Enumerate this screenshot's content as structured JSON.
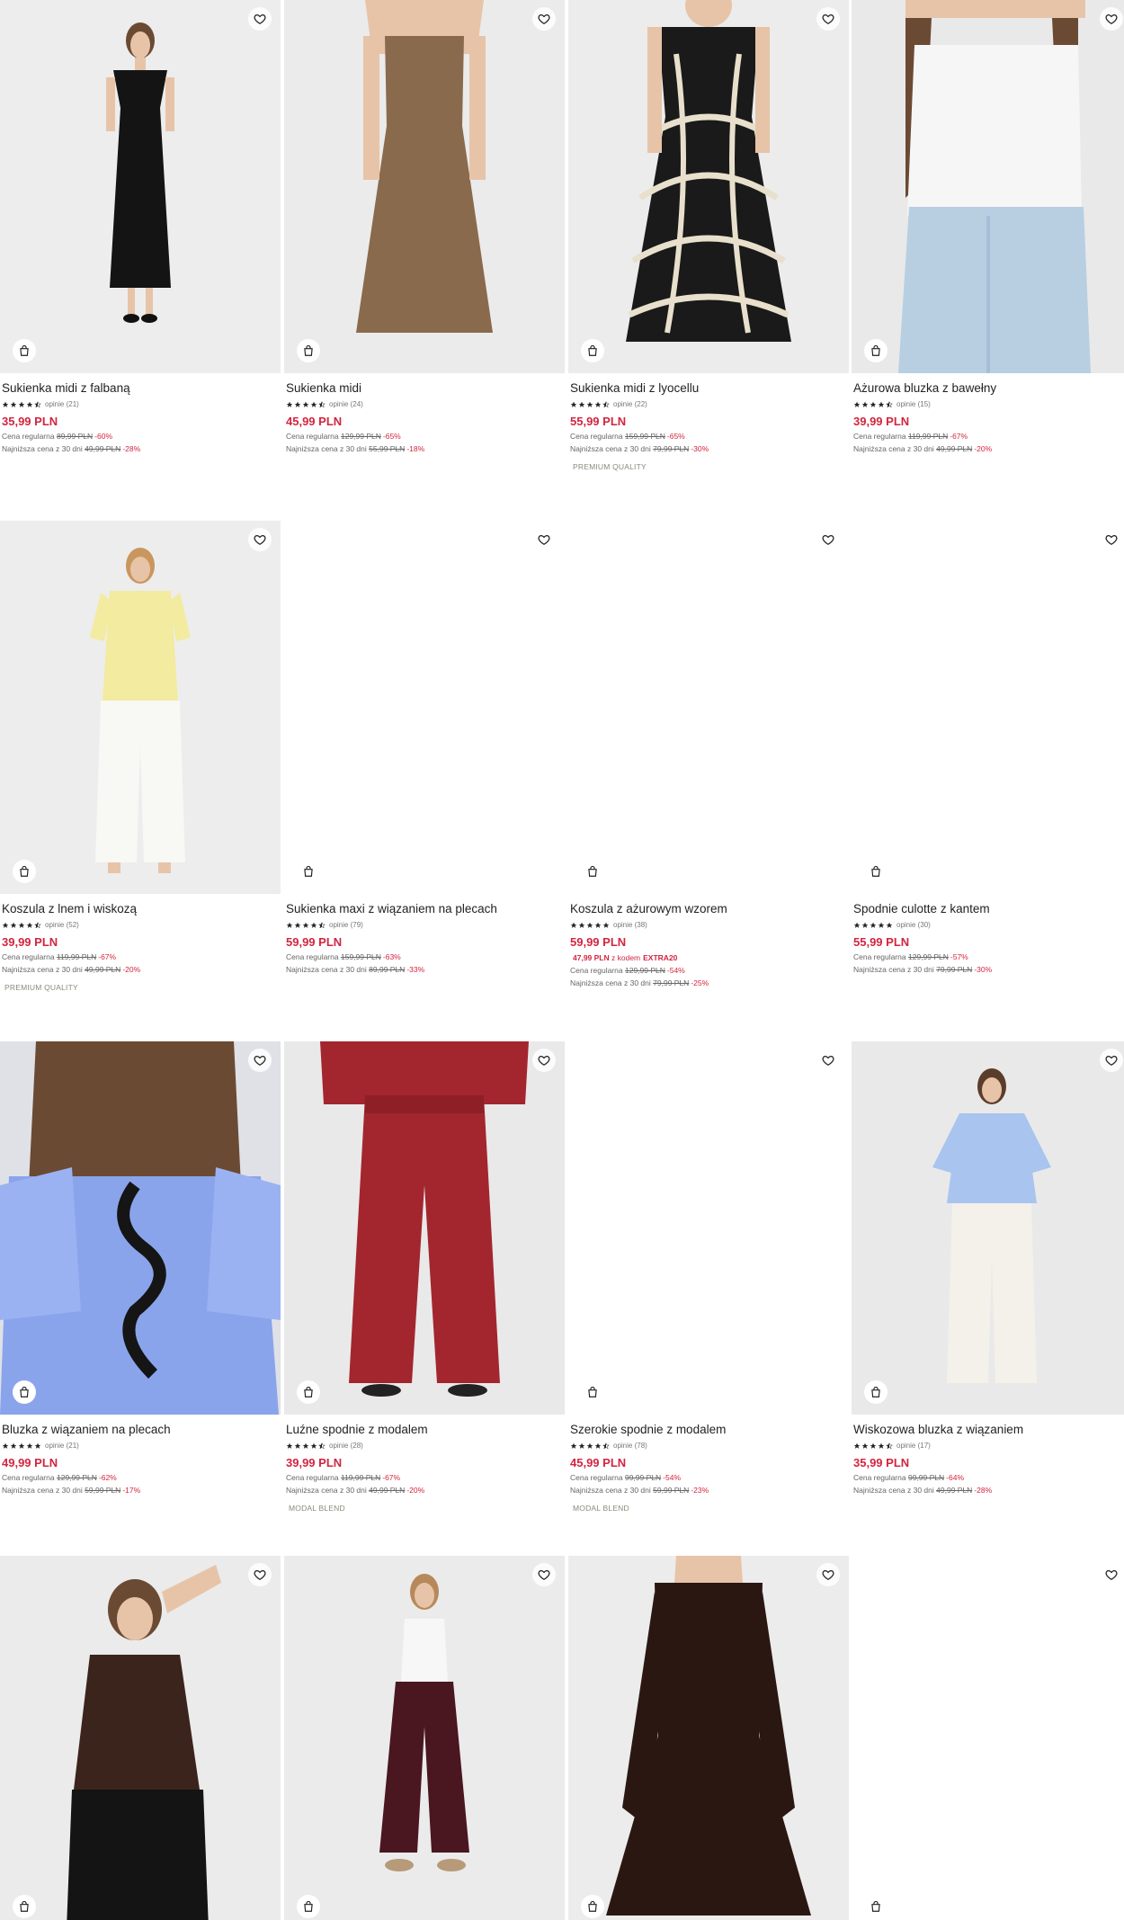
{
  "products": [
    {
      "name": "Sukienka midi z falbaną",
      "stars": 4.5,
      "reviews": "opinie (21)",
      "price": "35,99 PLN",
      "regular_label": "Cena regularna",
      "regular": "89,99 PLN",
      "regular_disc": "-60%",
      "lowest_label": "Najniższa cena z 30 dni",
      "lowest": "49,99 PLN",
      "lowest_disc": "-28%",
      "tag": "",
      "promo_price": "",
      "promo_label": "",
      "promo_code": "",
      "image": "black-dress"
    },
    {
      "name": "Sukienka midi",
      "stars": 4.5,
      "reviews": "opinie (24)",
      "price": "45,99 PLN",
      "regular_label": "Cena regularna",
      "regular": "129,99 PLN",
      "regular_disc": "-65%",
      "lowest_label": "Najniższa cena z 30 dni",
      "lowest": "55,99 PLN",
      "lowest_disc": "-18%",
      "tag": "",
      "promo_price": "",
      "promo_label": "",
      "promo_code": "",
      "image": "brown-dress"
    },
    {
      "name": "Sukienka midi z lyocellu",
      "stars": 4.5,
      "reviews": "opinie (22)",
      "price": "55,99 PLN",
      "regular_label": "Cena regularna",
      "regular": "159,99 PLN",
      "regular_disc": "-65%",
      "lowest_label": "Najniższa cena z 30 dni",
      "lowest": "79,99 PLN",
      "lowest_disc": "-30%",
      "tag": "PREMIUM QUALITY",
      "promo_price": "",
      "promo_label": "",
      "promo_code": "",
      "image": "pattern-dress"
    },
    {
      "name": "Ażurowa bluzka z bawełny",
      "stars": 4.5,
      "reviews": "opinie (15)",
      "price": "39,99 PLN",
      "regular_label": "Cena regularna",
      "regular": "119,99 PLN",
      "regular_disc": "-67%",
      "lowest_label": "Najniższa cena z 30 dni",
      "lowest": "49,99 PLN",
      "lowest_disc": "-20%",
      "tag": "",
      "promo_price": "",
      "promo_label": "",
      "promo_code": "",
      "image": "white-top"
    },
    {
      "name": "Koszula z lnem i wiskozą",
      "stars": 4.5,
      "reviews": "opinie (52)",
      "price": "39,99 PLN",
      "regular_label": "Cena regularna",
      "regular": "119,99 PLN",
      "regular_disc": "-67%",
      "lowest_label": "Najniższa cena z 30 dni",
      "lowest": "49,99 PLN",
      "lowest_disc": "-20%",
      "tag": "PREMIUM QUALITY",
      "promo_price": "",
      "promo_label": "",
      "promo_code": "",
      "image": "yellow-shirt"
    },
    {
      "name": "Sukienka maxi z wiązaniem na plecach",
      "stars": 4.5,
      "reviews": "opinie (79)",
      "price": "59,99 PLN",
      "regular_label": "Cena regularna",
      "regular": "159,99 PLN",
      "regular_disc": "-63%",
      "lowest_label": "Najniższa cena z 30 dni",
      "lowest": "89,99 PLN",
      "lowest_disc": "-33%",
      "tag": "",
      "promo_price": "",
      "promo_label": "",
      "promo_code": "",
      "image": "blank"
    },
    {
      "name": "Koszula z ażurowym wzorem",
      "stars": 5,
      "reviews": "opinie (38)",
      "price": "59,99 PLN",
      "regular_label": "Cena regularna",
      "regular": "129,99 PLN",
      "regular_disc": "-54%",
      "lowest_label": "Najniższa cena z 30 dni",
      "lowest": "79,99 PLN",
      "lowest_disc": "-25%",
      "tag": "",
      "promo_price": "47,99 PLN",
      "promo_label": "z kodem",
      "promo_code": "EXTRA20",
      "image": "blank"
    },
    {
      "name": "Spodnie culotte z kantem",
      "stars": 5,
      "reviews": "opinie (30)",
      "price": "55,99 PLN",
      "regular_label": "Cena regularna",
      "regular": "129,99 PLN",
      "regular_disc": "-57%",
      "lowest_label": "Najniższa cena z 30 dni",
      "lowest": "79,99 PLN",
      "lowest_disc": "-30%",
      "tag": "",
      "promo_price": "",
      "promo_label": "",
      "promo_code": "",
      "image": "blank"
    },
    {
      "name": "Bluzka z wiązaniem na plecach",
      "stars": 5,
      "reviews": "opinie (21)",
      "price": "49,99 PLN",
      "regular_label": "Cena regularna",
      "regular": "129,99 PLN",
      "regular_disc": "-62%",
      "lowest_label": "Najniższa cena z 30 dni",
      "lowest": "59,99 PLN",
      "lowest_disc": "-17%",
      "tag": "",
      "promo_price": "",
      "promo_label": "",
      "promo_code": "",
      "image": "blue-blouse"
    },
    {
      "name": "Luźne spodnie z modalem",
      "stars": 4.5,
      "reviews": "opinie (28)",
      "price": "39,99 PLN",
      "regular_label": "Cena regularna",
      "regular": "119,99 PLN",
      "regular_disc": "-67%",
      "lowest_label": "Najniższa cena z 30 dni",
      "lowest": "49,99 PLN",
      "lowest_disc": "-20%",
      "tag": "MODAL BLEND",
      "promo_price": "",
      "promo_label": "",
      "promo_code": "",
      "image": "red-trousers"
    },
    {
      "name": "Szerokie spodnie z modalem",
      "stars": 4.5,
      "reviews": "opinie (78)",
      "price": "45,99 PLN",
      "regular_label": "Cena regularna",
      "regular": "99,99 PLN",
      "regular_disc": "-54%",
      "lowest_label": "Najniższa cena z 30 dni",
      "lowest": "59,99 PLN",
      "lowest_disc": "-23%",
      "tag": "MODAL BLEND",
      "promo_price": "",
      "promo_label": "",
      "promo_code": "",
      "image": "blank"
    },
    {
      "name": "Wiskozowa bluzka z wiązaniem",
      "stars": 4.5,
      "reviews": "opinie (17)",
      "price": "35,99 PLN",
      "regular_label": "Cena regularna",
      "regular": "99,99 PLN",
      "regular_disc": "-64%",
      "lowest_label": "Najniższa cena z 30 dni",
      "lowest": "49,99 PLN",
      "lowest_disc": "-28%",
      "tag": "",
      "promo_price": "",
      "promo_label": "",
      "promo_code": "",
      "image": "lightblue-blouse"
    },
    {
      "name": "",
      "stars": 0,
      "reviews": "",
      "price": "",
      "image": "brown-top"
    },
    {
      "name": "",
      "stars": 0,
      "reviews": "",
      "price": "",
      "image": "burgundy-trousers"
    },
    {
      "name": "",
      "stars": 0,
      "reviews": "",
      "price": "",
      "image": "brown-dress-long"
    },
    {
      "name": "",
      "stars": 0,
      "reviews": "",
      "price": "",
      "image": "blank"
    }
  ],
  "icons": {
    "favorite": "heart-icon",
    "cart": "shopping-bag-icon",
    "rating": "star-icon"
  },
  "colors": {
    "price": "#d2253f",
    "text": "#222222",
    "tag": "#8a8a7a"
  }
}
